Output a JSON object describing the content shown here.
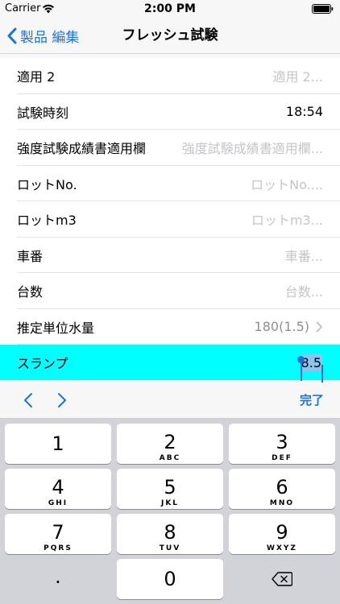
{
  "status_bar": {
    "carrier": "Carrier",
    "time": "2:00 PM"
  },
  "nav": {
    "back_label": "製品 編集",
    "title": "フレッシュ試験"
  },
  "rows": [
    {
      "label": "適用 2",
      "value": "適用 2...",
      "value_style": "placeholder"
    },
    {
      "label": "試験時刻",
      "value": "18:54",
      "value_style": "dark"
    },
    {
      "label": "強度試験成績書適用欄",
      "value": "強度試験成績書適用欄...",
      "value_style": "placeholder"
    },
    {
      "label": "ロットNo.",
      "value": "ロットNo....",
      "value_style": "placeholder"
    },
    {
      "label": "ロットm3",
      "value": "ロットm3...",
      "value_style": "placeholder"
    },
    {
      "label": "車番",
      "value": "車番...",
      "value_style": "placeholder"
    },
    {
      "label": "台数",
      "value": "台数...",
      "value_style": "placeholder"
    },
    {
      "label": "推定単位水量",
      "value": "180(1.5)",
      "value_style": "gray",
      "disclosure": true
    }
  ],
  "active_row": {
    "label": "スランプ",
    "value": "8.5"
  },
  "accessory": {
    "prev_icon": "chevron-left-icon",
    "next_icon": "chevron-right-icon",
    "done_label": "完了"
  },
  "keyboard": {
    "keys": [
      {
        "digit": "1",
        "letters": ""
      },
      {
        "digit": "2",
        "letters": "ABC"
      },
      {
        "digit": "3",
        "letters": "DEF"
      },
      {
        "digit": "4",
        "letters": "GHI"
      },
      {
        "digit": "5",
        "letters": "JKL"
      },
      {
        "digit": "6",
        "letters": "MNO"
      },
      {
        "digit": "7",
        "letters": "PQRS"
      },
      {
        "digit": "8",
        "letters": "TUV"
      },
      {
        "digit": "9",
        "letters": "WXYZ"
      },
      {
        "digit": "0",
        "letters": ""
      }
    ],
    "dot_label": ".",
    "delete_icon": "delete-backspace-icon"
  },
  "colors": {
    "accent": "#1a73d9",
    "active_row_bg": "#00ffff",
    "selection": "#8cc4f0",
    "keyboard_bg": "#d1d3d9"
  }
}
